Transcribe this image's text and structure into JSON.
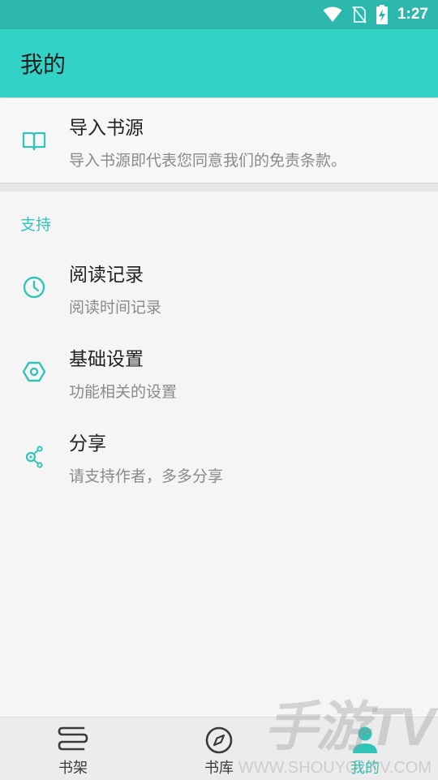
{
  "status_bar": {
    "time": "1:27",
    "icons": [
      "wifi-icon",
      "no-sim-icon",
      "battery-charging-icon"
    ]
  },
  "app_bar": {
    "title": "我的"
  },
  "import_source": {
    "icon": "book-open-icon",
    "title": "导入书源",
    "subtitle": "导入书源即代表您同意我们的免责条款。"
  },
  "support_section": {
    "header": "支持",
    "items": [
      {
        "icon": "clock-icon",
        "title": "阅读记录",
        "subtitle": "阅读时间记录"
      },
      {
        "icon": "hexagon-settings-icon",
        "title": "基础设置",
        "subtitle": "功能相关的设置"
      },
      {
        "icon": "share-icon",
        "title": "分享",
        "subtitle": "请支持作者，多多分享"
      }
    ]
  },
  "bottom_nav": {
    "items": [
      {
        "icon": "bookshelf-icon",
        "label": "书架",
        "active": false
      },
      {
        "icon": "compass-icon",
        "label": "书库",
        "active": false
      },
      {
        "icon": "person-icon",
        "label": "我的",
        "active": true
      }
    ]
  },
  "watermark": {
    "brand": "手游TV",
    "url": "WWW.SHOUYOUTV.COM"
  },
  "colors": {
    "accent": "#32d2c6",
    "status_bar": "#2db8ad",
    "active": "#2fc4b9"
  }
}
